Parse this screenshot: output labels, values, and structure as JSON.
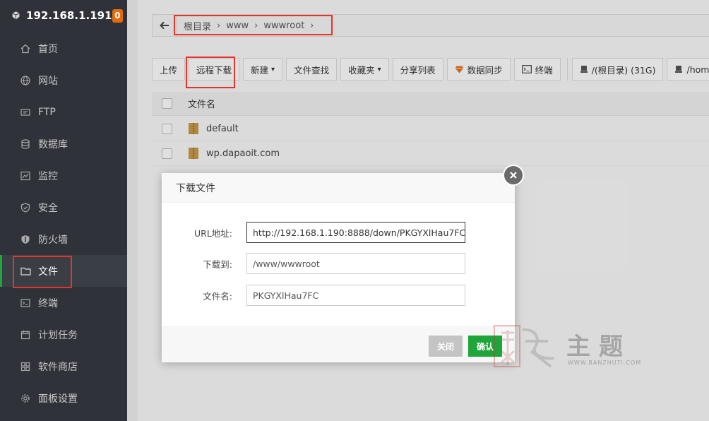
{
  "server": {
    "ip": "192.168.1.191",
    "badge": "0"
  },
  "sidebar": {
    "items": [
      {
        "label": "首页",
        "icon": "home-icon"
      },
      {
        "label": "网站",
        "icon": "globe-icon"
      },
      {
        "label": "FTP",
        "icon": "ftp-icon"
      },
      {
        "label": "数据库",
        "icon": "database-icon"
      },
      {
        "label": "监控",
        "icon": "monitor-icon"
      },
      {
        "label": "安全",
        "icon": "shield-icon"
      },
      {
        "label": "防火墙",
        "icon": "firewall-icon"
      },
      {
        "label": "文件",
        "icon": "folder-icon",
        "active": true
      },
      {
        "label": "终端",
        "icon": "terminal-icon"
      },
      {
        "label": "计划任务",
        "icon": "calendar-icon"
      },
      {
        "label": "软件商店",
        "icon": "apps-icon"
      },
      {
        "label": "面板设置",
        "icon": "gear-icon"
      }
    ]
  },
  "breadcrumb": [
    "根目录",
    "www",
    "wwwroot"
  ],
  "toolbar": {
    "upload": "上传",
    "remote_download": "远程下载",
    "new": "新建",
    "file_search": "文件查找",
    "favorites": "收藏夹",
    "share_list": "分享列表",
    "data_sync": "数据同步",
    "terminal": "终端",
    "disk_root": "/(根目录) (31G)",
    "disk_home": "/home"
  },
  "table": {
    "header": "文件名",
    "rows": [
      "default",
      "wp.dapaoit.com"
    ]
  },
  "dialog": {
    "title": "下载文件",
    "url_label": "URL地址:",
    "url_value": "http://192.168.1.190:8888/down/PKGYXlHau7FC",
    "dest_label": "下载到:",
    "dest_value": "/www/wwwroot",
    "name_label": "文件名:",
    "name_value": "PKGYXlHau7FC",
    "close_button": "关闭",
    "confirm_button": "确认"
  },
  "watermark": {
    "text": "主题",
    "url": "WWW.BANZHUTI.COM"
  },
  "colors": {
    "accent": "#20a53a",
    "sidebar_bg": "#2f3238",
    "annotation": "#e8332a",
    "badge": "#e36c0a"
  }
}
